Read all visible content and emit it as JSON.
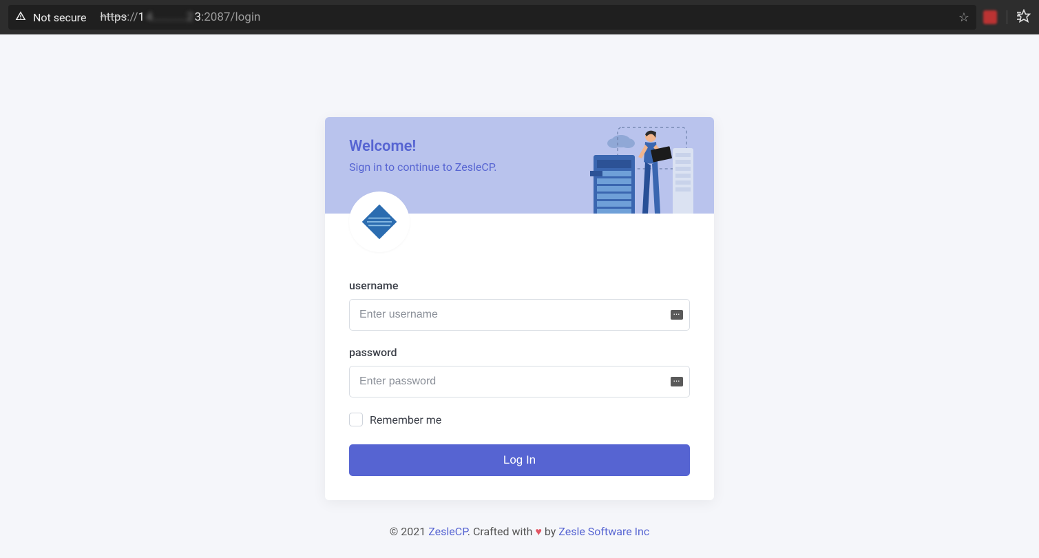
{
  "browser": {
    "not_secure_label": "Not secure",
    "url_https": "https",
    "url_sep": "://",
    "url_visible_start": "1",
    "url_blurred": "4...........2",
    "url_visible_end": "3",
    "url_port_path": ":2087/login"
  },
  "header": {
    "title": "Welcome!",
    "subtitle": "Sign in to continue to ZesleCP."
  },
  "form": {
    "username_label": "username",
    "username_placeholder": "Enter username",
    "username_value": "",
    "password_label": "password",
    "password_placeholder": "Enter password",
    "password_value": "",
    "remember_label": "Remember me",
    "login_button": "Log In"
  },
  "footer": {
    "copyright": "© 2021 ",
    "brand": "ZesleCP",
    "crafted": ". Crafted with ",
    "heart": "♥",
    "by": " by ",
    "company": "Zesle Software Inc"
  },
  "colors": {
    "accent": "#5664d2",
    "header_bg": "#b9c3ed",
    "page_bg": "#f5f6fa"
  }
}
